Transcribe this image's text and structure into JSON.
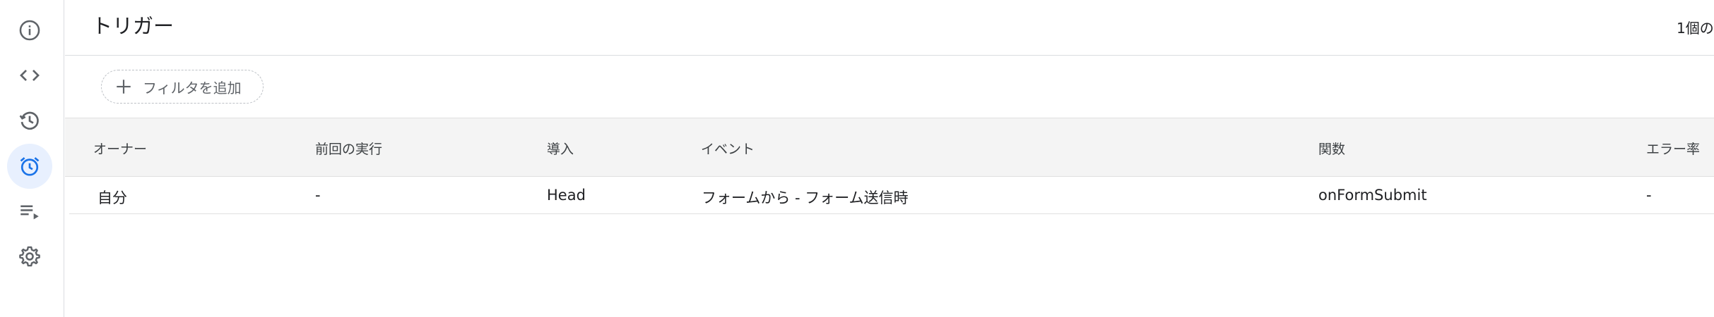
{
  "sidebar": {
    "items": [
      {
        "name": "overview",
        "icon": "info-icon"
      },
      {
        "name": "editor",
        "icon": "code-icon"
      },
      {
        "name": "executions",
        "icon": "history-icon"
      },
      {
        "name": "triggers",
        "icon": "alarm-icon",
        "active": true
      },
      {
        "name": "executions-log",
        "icon": "playlist-icon"
      },
      {
        "name": "settings",
        "icon": "gear-icon"
      }
    ]
  },
  "header": {
    "title": "トリガー",
    "count_text": "1個の"
  },
  "filter": {
    "add_label": "フィルタを追加"
  },
  "table": {
    "columns": [
      "オーナー",
      "前回の実行",
      "導入",
      "イベント",
      "関数",
      "エラー率"
    ],
    "rows": [
      {
        "owner": "自分",
        "last_run": "-",
        "deployment": "Head",
        "event": "フォームから - フォーム送信時",
        "function": "onFormSubmit",
        "error_rate": "-"
      }
    ]
  },
  "colors": {
    "accent": "#1a73e8",
    "active_bg": "#e8f0fe",
    "icon_gray": "#5f6368",
    "border": "#dadce0",
    "header_bg": "#f4f4f4"
  }
}
